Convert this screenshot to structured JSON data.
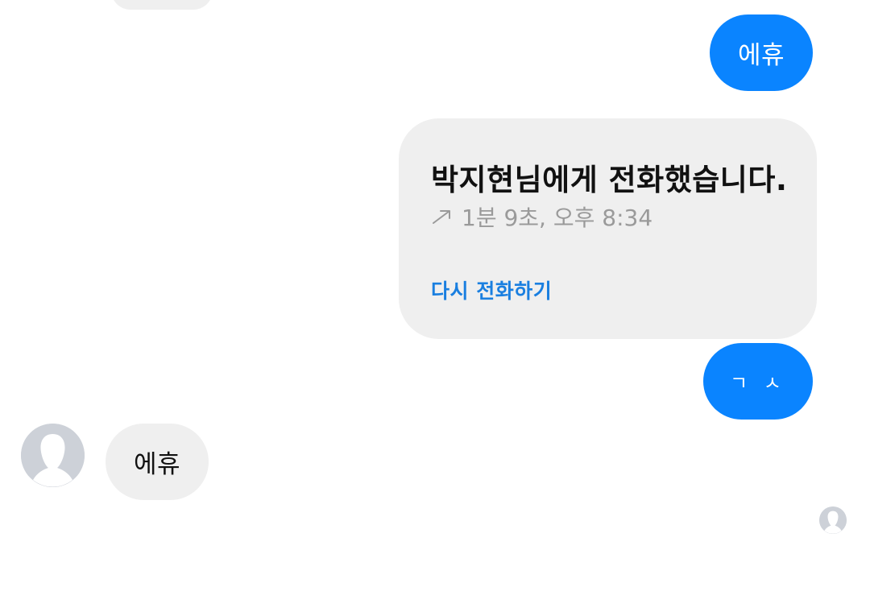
{
  "messages": {
    "outgoing_1": {
      "text": "에휴"
    },
    "call_card": {
      "title": "박지현님에게 전화했습니다.",
      "arrow_icon": "outgoing-call-arrow-icon",
      "meta": "1분 9초, 오후 8:34",
      "action_label": "다시 전화하기"
    },
    "outgoing_2": {
      "text": "ㄱ ㅅ"
    },
    "incoming_1": {
      "text": "에휴",
      "avatar_icon": "default-profile-avatar"
    },
    "seen_indicator": {
      "icon": "seen-avatar-icon"
    }
  },
  "colors": {
    "outgoing_bubble": "#0a84ff",
    "incoming_bubble": "#efefef",
    "link_blue": "#1a7fe0",
    "meta_gray": "#9a9a9a",
    "avatar_gray": "#cdd1d8"
  }
}
